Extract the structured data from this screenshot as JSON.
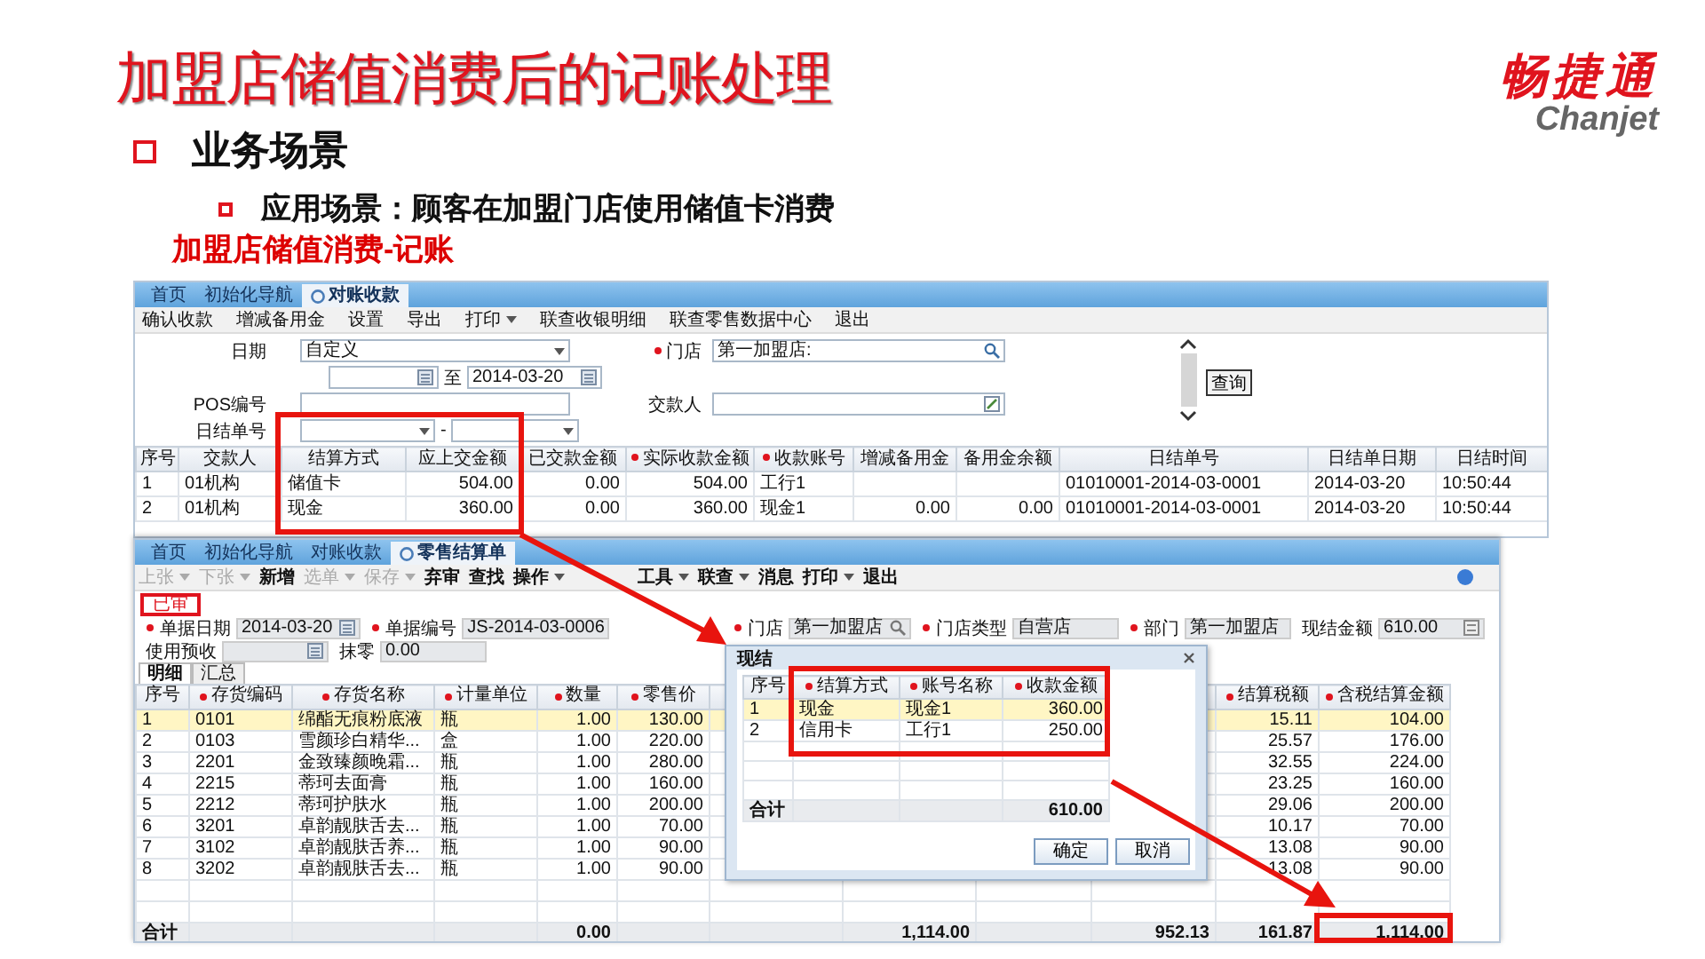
{
  "title": "加盟店储值消费后的记账处理",
  "logo": {
    "name": "畅捷通",
    "latin": "Chanjet"
  },
  "bullets": [
    {
      "kind": "main",
      "text": "业务场景"
    },
    {
      "kind": "sub",
      "text": "应用场景：顾客在加盟门店使用储值卡消费"
    }
  ],
  "section_heading": "加盟店储值消费-记账",
  "reconcile_window": {
    "tabs": [
      {
        "label": "首页",
        "selected": false
      },
      {
        "label": "初始化导航",
        "selected": false
      },
      {
        "label": "对账收款",
        "selected": true
      }
    ],
    "toolbar": [
      {
        "label": "确认收款",
        "dropdown": false
      },
      {
        "label": "增减备用金",
        "dropdown": false
      },
      {
        "label": "设置",
        "dropdown": false
      },
      {
        "label": "导出",
        "dropdown": false
      },
      {
        "label": "打印",
        "dropdown": true
      },
      {
        "label": "联查收银明细",
        "dropdown": false
      },
      {
        "label": "联查零售数据中心",
        "dropdown": false
      },
      {
        "label": "退出",
        "dropdown": false
      }
    ],
    "form": {
      "date_label": "日期",
      "date_mode": "自定义",
      "to_label": "至",
      "date_to": "2014-03-20",
      "store_label": "门店",
      "store_required": true,
      "store": "第一加盟店:",
      "pos_label": "POS编号",
      "payer_label": "交款人",
      "daily_no_label": "日结单号",
      "range_separator": "-",
      "query_button": "查询"
    },
    "table": {
      "columns": [
        {
          "label": "序号",
          "required": false
        },
        {
          "label": "交款人",
          "required": false
        },
        {
          "label": "结算方式",
          "required": false
        },
        {
          "label": "应上交金额",
          "required": false
        },
        {
          "label": "已交款金额",
          "required": false
        },
        {
          "label": "实际收款金额",
          "required": true
        },
        {
          "label": "收款账号",
          "required": true
        },
        {
          "label": "增减备用金",
          "required": false
        },
        {
          "label": "备用金余额",
          "required": false
        },
        {
          "label": "日结单号",
          "required": false
        },
        {
          "label": "日结单日期",
          "required": false
        },
        {
          "label": "日结时间",
          "required": false
        }
      ],
      "rows": [
        {
          "selected": false,
          "cells": [
            "1",
            "01机构",
            "储值卡",
            "504.00",
            "0.00",
            "504.00",
            "工行1",
            null,
            null,
            "01010001-2014-03-0001",
            "2014-03-20",
            "10:50:44"
          ]
        },
        {
          "selected": false,
          "cells": [
            "2",
            "01机构",
            "现金",
            "360.00",
            "0.00",
            "360.00",
            "现金1",
            "0.00",
            "0.00",
            "01010001-2014-03-0001",
            "2014-03-20",
            "10:50:44"
          ]
        }
      ]
    }
  },
  "settlement_window": {
    "tabs": [
      {
        "label": "首页",
        "selected": false
      },
      {
        "label": "初始化导航",
        "selected": false
      },
      {
        "label": "对账收款",
        "selected": false
      },
      {
        "label": "零售结算单",
        "selected": true
      }
    ],
    "toolbar": [
      {
        "label": "上张",
        "dropdown": true,
        "disabled": true
      },
      {
        "label": "下张",
        "dropdown": true,
        "disabled": true
      },
      {
        "label": "新增",
        "dropdown": false,
        "disabled": false
      },
      {
        "label": "选单",
        "dropdown": true,
        "disabled": true
      },
      {
        "label": "保存",
        "dropdown": true,
        "disabled": true
      },
      {
        "label": "弃审",
        "dropdown": false,
        "disabled": false
      },
      {
        "label": "查找",
        "dropdown": false,
        "disabled": false
      },
      {
        "label": "操作",
        "dropdown": true,
        "disabled": false
      },
      {
        "label": "工具",
        "dropdown": true,
        "disabled": false
      },
      {
        "label": "联查",
        "dropdown": true,
        "disabled": false
      },
      {
        "label": "消息",
        "dropdown": false,
        "disabled": false
      },
      {
        "label": "打印",
        "dropdown": true,
        "disabled": false
      },
      {
        "label": "退出",
        "dropdown": false,
        "disabled": false
      }
    ],
    "status": "已审",
    "field_rows": [
      [
        {
          "label": "单据日期",
          "required": true,
          "value": "2014-03-20",
          "kind": "calendar"
        },
        {
          "label": "单据编号",
          "required": true,
          "value": "JS-2014-03-0006",
          "kind": "plain"
        },
        {
          "label": "门店",
          "required": true,
          "value": "第一加盟店",
          "kind": "search"
        },
        {
          "label": "门店类型",
          "required": true,
          "value": "自营店",
          "kind": "plain"
        },
        {
          "label": "部门",
          "required": true,
          "value": "第一加盟店",
          "kind": "plain"
        },
        {
          "label": "现结金额",
          "required": false,
          "value": "610.00",
          "kind": "calculator"
        }
      ],
      [
        {
          "label": "使用预收",
          "required": false,
          "kind": "calendar"
        },
        {
          "label": "抹零",
          "required": false,
          "value": "0.00",
          "kind": "plain"
        }
      ]
    ],
    "detail_tabs": [
      {
        "label": "明细",
        "selected": true
      },
      {
        "label": "汇总",
        "selected": false
      }
    ],
    "table": {
      "columns": [
        {
          "label": "序号",
          "required": false
        },
        {
          "label": "存货编码",
          "required": true
        },
        {
          "label": "存货名称",
          "required": true
        },
        {
          "label": "计量单位",
          "required": true
        },
        {
          "label": "数量",
          "required": true
        },
        {
          "label": "零售价",
          "required": true
        },
        null,
        null,
        null,
        null,
        {
          "label": "结算税额",
          "required": true
        },
        {
          "label": "含税结算金额",
          "required": true
        }
      ],
      "rows": [
        {
          "selected": true,
          "cells": [
            "1",
            "0101",
            "绵酯无痕粉底液",
            "瓶",
            "1.00",
            "130.00",
            null,
            null,
            null,
            null,
            "15.11",
            "104.00"
          ]
        },
        {
          "selected": false,
          "cells": [
            "2",
            "0103",
            "雪颜珍白精华...",
            "盒",
            "1.00",
            "220.00",
            null,
            null,
            null,
            null,
            "25.57",
            "176.00"
          ]
        },
        {
          "selected": false,
          "cells": [
            "3",
            "2201",
            "金致臻颜晚霜...",
            "瓶",
            "1.00",
            "280.00",
            null,
            null,
            null,
            null,
            "32.55",
            "224.00"
          ]
        },
        {
          "selected": false,
          "cells": [
            "4",
            "2215",
            "蒂珂去面膏",
            "瓶",
            "1.00",
            "160.00",
            null,
            null,
            null,
            null,
            "23.25",
            "160.00"
          ]
        },
        {
          "selected": false,
          "cells": [
            "5",
            "2212",
            "蒂珂护肤水",
            "瓶",
            "1.00",
            "200.00",
            null,
            null,
            null,
            null,
            "29.06",
            "200.00"
          ]
        },
        {
          "selected": false,
          "cells": [
            "6",
            "3201",
            "卓韵靓肤舌去...",
            "瓶",
            "1.00",
            "70.00",
            null,
            null,
            null,
            null,
            "10.17",
            "70.00"
          ]
        },
        {
          "selected": false,
          "cells": [
            "7",
            "3102",
            "卓韵靓肤舌养...",
            "瓶",
            "1.00",
            "90.00",
            null,
            null,
            null,
            null,
            "13.08",
            "90.00"
          ]
        },
        {
          "selected": false,
          "cells": [
            "8",
            "3202",
            "卓韵靓肤舌去...",
            "瓶",
            "1.00",
            "90.00",
            null,
            null,
            null,
            null,
            "13.08",
            "90.00"
          ]
        }
      ],
      "total": {
        "label": "合计",
        "quantity": "0.00",
        "column_8": "1,114.00",
        "column_10": "952.13",
        "tax": "161.87",
        "amount_with_tax": "1,114.00"
      }
    }
  },
  "settle_dialog": {
    "title": "现结",
    "columns": [
      {
        "label": "序号",
        "required": false
      },
      {
        "label": "结算方式",
        "required": true
      },
      {
        "label": "账号名称",
        "required": true
      },
      {
        "label": "收款金额",
        "required": true
      }
    ],
    "rows": [
      {
        "selected": true,
        "cells": [
          "1",
          "现金",
          "现金1",
          "360.00"
        ]
      },
      {
        "selected": false,
        "cells": [
          "2",
          "信用卡",
          "工行1",
          "250.00"
        ]
      }
    ],
    "total": {
      "label": "合计",
      "amount": "610.00"
    },
    "buttons": [
      "确定",
      "取消"
    ]
  }
}
